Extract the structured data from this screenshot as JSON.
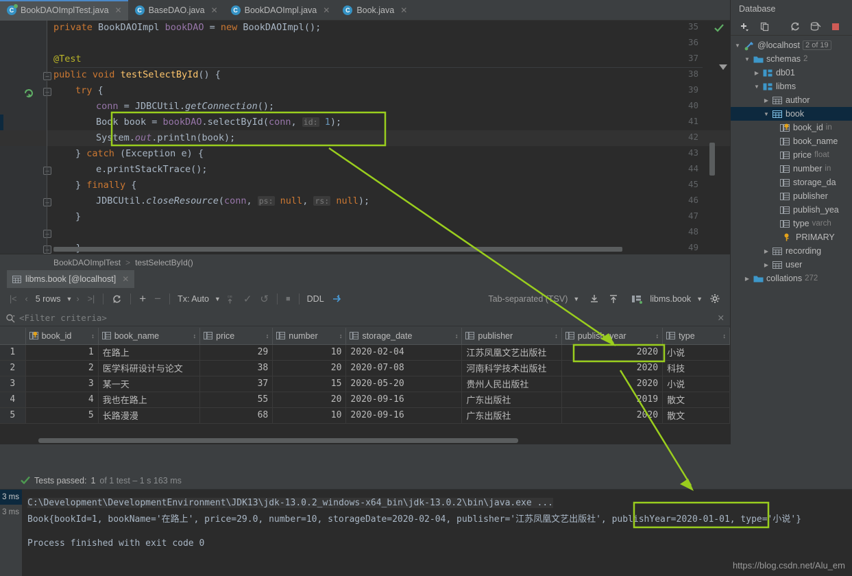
{
  "editor_tabs": [
    {
      "label": "BookDAOImplTest.java",
      "icon": "java-test-class-icon",
      "active": true
    },
    {
      "label": "BaseDAO.java",
      "icon": "java-class-icon",
      "active": false
    },
    {
      "label": "BookDAOImpl.java",
      "icon": "java-class-icon",
      "active": false
    },
    {
      "label": "Book.java",
      "icon": "java-class-icon",
      "active": false
    }
  ],
  "code": {
    "lines": [
      {
        "n": "35",
        "text": "    private BookDAOImpl bookDAO = new BookDAOImpl();"
      },
      {
        "n": "36",
        "text": ""
      },
      {
        "n": "37",
        "text": "    @Test"
      },
      {
        "n": "38",
        "text": "    public void testSelectById() {"
      },
      {
        "n": "39",
        "text": "        try {"
      },
      {
        "n": "40",
        "text": "            conn = JDBCUtil.getConnection();"
      },
      {
        "n": "41",
        "text": "            Book book = bookDAO.selectById(conn, id: 1);"
      },
      {
        "n": "42",
        "text": "            System.out.println(book);"
      },
      {
        "n": "43",
        "text": "        } catch (Exception e) {"
      },
      {
        "n": "44",
        "text": "            e.printStackTrace();"
      },
      {
        "n": "45",
        "text": "        } finally {"
      },
      {
        "n": "46",
        "text": "            JDBCUtil.closeResource(conn, ps: null, rs: null);"
      },
      {
        "n": "47",
        "text": "        }"
      },
      {
        "n": "48",
        "text": ""
      },
      {
        "n": "49",
        "text": "    }"
      }
    ]
  },
  "breadcrumb": {
    "class": "BookDAOImplTest",
    "separator": ">",
    "method": "testSelectById()"
  },
  "db_console_tab": {
    "label": "libms.book [@localhost]",
    "icon": "table-icon",
    "close": "✕"
  },
  "grid_toolbar": {
    "first_label": "|<",
    "prev_label": "‹",
    "rows_label": "5 rows",
    "next_label": "›",
    "last_label": ">|",
    "reload_label": "reload-icon",
    "add_label": "+",
    "remove_label": "−",
    "tx_label": "Tx: Auto",
    "db_upload_label": "db-upload-icon",
    "commit_label": "✓",
    "rollback_label": "↺",
    "stop_label": "■",
    "ddl_label": "DDL",
    "more_label": "expand-icon",
    "format_label": "Tab-separated (TSV)",
    "export_label": "download-icon",
    "import_label": "upload-icon",
    "schema_label": "libms.book",
    "settings_label": "gear-icon"
  },
  "filter": {
    "placeholder": "<Filter criteria>",
    "search_icon": "search-icon",
    "close_icon": "✕"
  },
  "grid": {
    "columns": [
      {
        "name": "book_id",
        "icon": "primary-key-column-icon",
        "align": "right"
      },
      {
        "name": "book_name",
        "icon": "column-icon",
        "align": "left"
      },
      {
        "name": "price",
        "icon": "column-icon",
        "align": "right"
      },
      {
        "name": "number",
        "icon": "column-icon",
        "align": "right"
      },
      {
        "name": "storage_date",
        "icon": "column-icon",
        "align": "left"
      },
      {
        "name": "publisher",
        "icon": "column-icon",
        "align": "left"
      },
      {
        "name": "publish_year",
        "icon": "column-icon",
        "align": "right"
      },
      {
        "name": "type",
        "icon": "column-icon",
        "align": "left"
      }
    ],
    "rows": [
      {
        "n": "1",
        "book_id": "1",
        "book_name": "在路上",
        "price": "29",
        "number": "10",
        "storage_date": "2020-02-04",
        "publisher": "江苏凤凰文艺出版社",
        "publish_year": "2020",
        "type": "小说"
      },
      {
        "n": "2",
        "book_id": "2",
        "book_name": "医学科研设计与论文",
        "price": "38",
        "number": "20",
        "storage_date": "2020-07-08",
        "publisher": "河南科学技术出版社",
        "publish_year": "2020",
        "type": "科技"
      },
      {
        "n": "3",
        "book_id": "3",
        "book_name": "某一天",
        "price": "37",
        "number": "15",
        "storage_date": "2020-05-20",
        "publisher": "贵州人民出版社",
        "publish_year": "2020",
        "type": "小说"
      },
      {
        "n": "4",
        "book_id": "4",
        "book_name": "我也在路上",
        "price": "55",
        "number": "20",
        "storage_date": "2020-09-16",
        "publisher": "广东出版社",
        "publish_year": "2019",
        "type": "散文"
      },
      {
        "n": "5",
        "book_id": "5",
        "book_name": "长路漫漫",
        "price": "68",
        "number": "10",
        "storage_date": "2020-09-16",
        "publisher": "广东出版社",
        "publish_year": "2020",
        "type": "散文"
      }
    ]
  },
  "database_panel": {
    "title": "Database",
    "toolbar": [
      "add-icon",
      "copy-icon",
      "refresh-icon",
      "jump-to-query-icon",
      "stop-icon",
      "table-editor-icon"
    ],
    "tree": [
      {
        "indent": 0,
        "arrow": "▼",
        "icon": "datasource-icon",
        "label": "@localhost",
        "badge": "2 of 19"
      },
      {
        "indent": 1,
        "arrow": "▼",
        "icon": "folder-icon",
        "label": "schemas",
        "meta": "2"
      },
      {
        "indent": 2,
        "arrow": "▶",
        "icon": "schema-icon",
        "label": "db01",
        "meta": ""
      },
      {
        "indent": 2,
        "arrow": "▼",
        "icon": "schema-icon",
        "label": "libms",
        "meta": ""
      },
      {
        "indent": 3,
        "arrow": "▶",
        "icon": "table-icon",
        "label": "author",
        "meta": ""
      },
      {
        "indent": 3,
        "arrow": "▼",
        "icon": "table-icon",
        "label": "book",
        "meta": "",
        "selected": true
      },
      {
        "indent": 4,
        "arrow": "",
        "icon": "pk-column-icon",
        "label": "book_id",
        "meta": "in"
      },
      {
        "indent": 4,
        "arrow": "",
        "icon": "column-icon",
        "label": "book_name",
        "meta": ""
      },
      {
        "indent": 4,
        "arrow": "",
        "icon": "column-icon",
        "label": "price",
        "meta": "float"
      },
      {
        "indent": 4,
        "arrow": "",
        "icon": "column-icon",
        "label": "number",
        "meta": "in"
      },
      {
        "indent": 4,
        "arrow": "",
        "icon": "column-icon",
        "label": "storage_da",
        "meta": ""
      },
      {
        "indent": 4,
        "arrow": "",
        "icon": "column-icon",
        "label": "publisher",
        "meta": ""
      },
      {
        "indent": 4,
        "arrow": "",
        "icon": "column-icon",
        "label": "publish_yea",
        "meta": ""
      },
      {
        "indent": 4,
        "arrow": "",
        "icon": "column-icon",
        "label": "type",
        "meta": "varch"
      },
      {
        "indent": 4,
        "arrow": "",
        "icon": "key-icon",
        "label": "PRIMARY",
        "meta": ""
      },
      {
        "indent": 3,
        "arrow": "▶",
        "icon": "table-icon",
        "label": "recording",
        "meta": ""
      },
      {
        "indent": 3,
        "arrow": "▶",
        "icon": "table-icon",
        "label": "user",
        "meta": ""
      },
      {
        "indent": 1,
        "arrow": "▶",
        "icon": "folder-icon",
        "label": "collations",
        "meta": "272"
      }
    ]
  },
  "test_status": {
    "check_icon": "green-check-icon",
    "label": "Tests passed:",
    "count": "1",
    "detail": "of 1 test – 1 s 163 ms"
  },
  "test_tree_timings": [
    "3 ms",
    "3 ms"
  ],
  "console": {
    "command": "C:\\Development\\DevelopmentEnvironment\\JDK13\\jdk-13.0.2_windows-x64_bin\\jdk-13.0.2\\bin\\java.exe ...",
    "output_pre": "Book{bookId=1, bookName='在路上', price=29.0, number=10, storageDate=2020-02-04, publisher='江苏凤凰文艺出版社', ",
    "output_highlight": "publishYear=2020-01-01,",
    "output_post": " type='小说'}",
    "exit": "Process finished with exit code 0"
  },
  "watermark": "https://blog.csdn.net/Alu_em",
  "colors": {
    "accent_green": "#9ace1e",
    "selection_blue": "#0d293e",
    "editor_bg": "#2b2b2b",
    "panel_bg": "#3c3f41",
    "tab_active": "#4e5254",
    "keyword": "#cc7832",
    "field": "#9876aa",
    "method": "#ffc66d",
    "number": "#6897bb",
    "annotation": "#bbb529",
    "text": "#a9b7c6"
  }
}
